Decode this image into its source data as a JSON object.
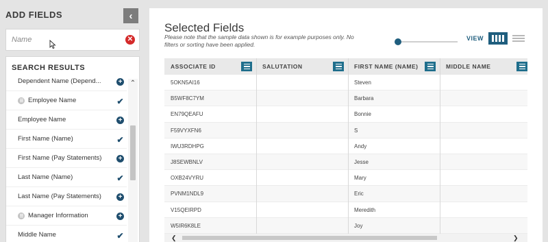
{
  "left_panel": {
    "title": "ADD FIELDS",
    "search": {
      "placeholder": "Name",
      "value": ""
    },
    "results_title": "SEARCH RESULTS",
    "results": [
      {
        "label": "Dependent Name (Depend...",
        "action": "add",
        "group": false
      },
      {
        "label": "Employee Name",
        "action": "added",
        "group": true
      },
      {
        "label": "Employee Name",
        "action": "add",
        "group": false
      },
      {
        "label": "First Name (Name)",
        "action": "added",
        "group": false
      },
      {
        "label": "First Name (Pay Statements)",
        "action": "add",
        "group": false
      },
      {
        "label": "Last Name (Name)",
        "action": "added",
        "group": false
      },
      {
        "label": "Last Name (Pay Statements)",
        "action": "add",
        "group": false
      },
      {
        "label": "Manager Information",
        "action": "add",
        "group": true
      },
      {
        "label": "Middle Name",
        "action": "added",
        "group": false
      }
    ]
  },
  "main": {
    "title": "Selected Fields",
    "note": "Please note that the sample data shown is for example purposes only. No filters or sorting have been applied.",
    "view_label": "VIEW",
    "active_view": "grid",
    "columns": [
      "ASSOCIATE ID",
      "SALUTATION",
      "FIRST NAME (NAME)",
      "MIDDLE NAME"
    ],
    "rows": [
      [
        "5OKN5AI16",
        "",
        "Steven",
        ""
      ],
      [
        "B5WF8C7YM",
        "",
        "Barbara",
        ""
      ],
      [
        "EN79QEAFU",
        "",
        "Bonnie",
        ""
      ],
      [
        "F59VYXFN6",
        "",
        "S",
        ""
      ],
      [
        "IWU3RDHPG",
        "",
        "Andy",
        ""
      ],
      [
        "J8SEWBNLV",
        "",
        "Jesse",
        ""
      ],
      [
        "OXB24VYRU",
        "",
        "Mary",
        ""
      ],
      [
        "PVNM1NDL9",
        "",
        "Eric",
        ""
      ],
      [
        "V15QEIRPD",
        "",
        "Meredith",
        ""
      ],
      [
        "W5IR6K8LE",
        "",
        "Joy",
        ""
      ]
    ]
  },
  "icons": {
    "collapse": "chevron-left-icon",
    "clear": "close-circle-icon",
    "add": "plus-circle-icon",
    "added": "check-icon",
    "group": "group-icon",
    "column_menu": "menu-icon",
    "grid_view": "grid-view-icon",
    "list_view": "list-view-icon"
  },
  "colors": {
    "accent": "#1f5e7e",
    "clear": "#d42a2a",
    "background": "#e4e4e4"
  }
}
